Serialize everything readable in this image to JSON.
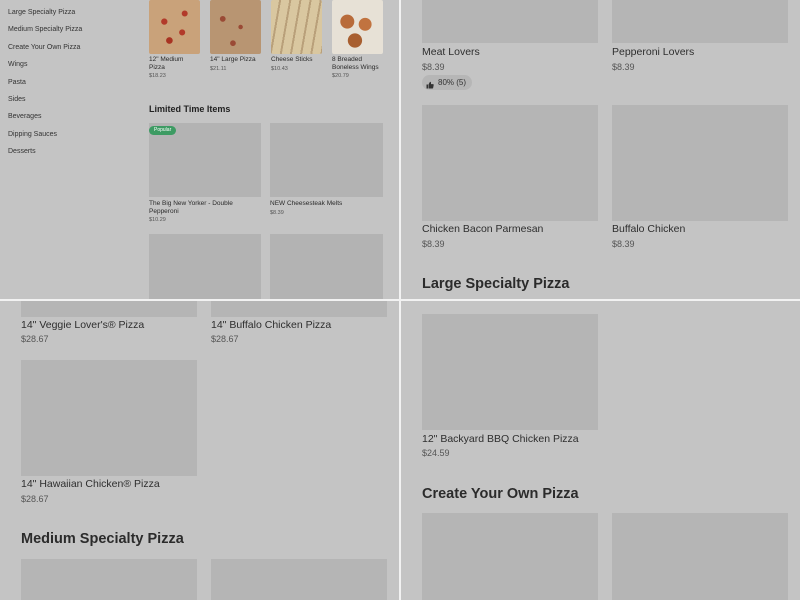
{
  "sidebar": {
    "categories": [
      "Large Specialty Pizza",
      "Medium Specialty Pizza",
      "Create Your Own Pizza",
      "Wings",
      "Pasta",
      "Sides",
      "Beverages",
      "Dipping Sauces",
      "Desserts"
    ]
  },
  "featured_items": [
    {
      "name": "12\" Medium Pizza",
      "price": "$18.23"
    },
    {
      "name": "14\" Large Pizza",
      "price": "$21.11"
    },
    {
      "name": "Cheese Sticks",
      "price": "$10.43"
    },
    {
      "name": "8 Breaded Boneless Wings",
      "price": "$20.79"
    }
  ],
  "limited_time": {
    "heading": "Limited Time Items",
    "badge": "Popular",
    "items": [
      {
        "name": "The Big New Yorker - Double Pepperoni",
        "price": "$10.29"
      },
      {
        "name": "NEW Cheesesteak Melts",
        "price": "$8.39"
      }
    ]
  },
  "top_right": {
    "items": [
      {
        "name": "Meat Lovers",
        "price": "$8.39"
      },
      {
        "name": "Pepperoni Lovers",
        "price": "$8.39"
      },
      {
        "name": "Chicken Bacon Parmesan",
        "price": "$8.39"
      },
      {
        "name": "Buffalo Chicken",
        "price": "$8.39"
      }
    ],
    "rating": "80% (5)",
    "section_heading": "Large Specialty Pizza"
  },
  "bottom_left": {
    "items": [
      {
        "name": "14\" Veggie Lover's® Pizza",
        "price": "$28.67"
      },
      {
        "name": "14\" Buffalo Chicken Pizza",
        "price": "$28.67"
      },
      {
        "name": "14\" Hawaiian Chicken® Pizza",
        "price": "$28.67"
      }
    ],
    "section_heading": "Medium Specialty Pizza"
  },
  "bottom_right": {
    "items": [
      {
        "name": "12\" Backyard BBQ Chicken Pizza",
        "price": "$24.59"
      }
    ],
    "section_heading": "Create Your Own Pizza"
  },
  "colors": {
    "overlay": "#c4c4c4",
    "badge": "#3d9b63",
    "divider": "#f2f2f2"
  }
}
